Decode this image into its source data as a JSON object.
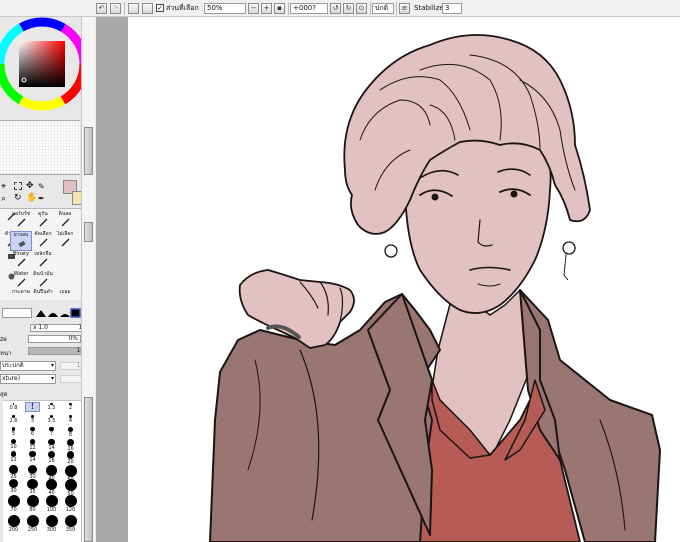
{
  "toolbar": {
    "selection_checkbox_label": "ส่วนที่เลือก",
    "zoom_value": "50%",
    "rotation_value": "+000?",
    "blend_mode_value": "ปกติ",
    "stabilize_label": "Stabilize",
    "stabilize_value": "3"
  },
  "brushes": {
    "row1": [
      "แอร์บรัช",
      "ดูกัน",
      "ดินสอ"
    ],
    "row2": [
      "ตัวลบ",
      "ยางลบ",
      "ตัดเลือก",
      "ไม่เลือก"
    ],
    "row3": [
      "Binary",
      "เหล็กจืม"
    ],
    "row4": [
      "Water",
      "ดินน้ำมัน"
    ],
    "row5": [
      "กระดาษ",
      "ดินปืนดำ",
      "เบลอ"
    ]
  },
  "brush_settings": {
    "size_multiplier": "x 1.0",
    "size_value": "1.0",
    "size_label": "ze",
    "min_size_value": "0%",
    "density_label": "หนา",
    "density_value": "100",
    "mode_value": "ประปกติ",
    "mode_right_value": "100",
    "texture_value": "xture)",
    "texture_right_value": "95",
    "size_header": "สุด"
  },
  "sizes": [
    [
      "0.8",
      "1",
      "1.5",
      "2"
    ],
    [
      "2.6",
      "3",
      "3.5",
      "4"
    ],
    [
      "5",
      "6",
      "7",
      "8"
    ],
    [
      "10",
      "12",
      "14",
      "16"
    ],
    [
      "12",
      "14",
      "16",
      "20"
    ],
    [
      "25",
      "30",
      "40",
      "50"
    ],
    [
      "30",
      "35",
      "40",
      "50"
    ],
    [
      "70",
      "80",
      "100",
      "120"
    ],
    [
      "200",
      "250",
      "300",
      "350"
    ]
  ],
  "colors": {
    "main": "#ddc0c0",
    "sub": "#f3e4b0",
    "skin": "#e1c1c1",
    "jacket": "#9a7672",
    "shirt": "#b65b55",
    "line": "#1a1414"
  }
}
